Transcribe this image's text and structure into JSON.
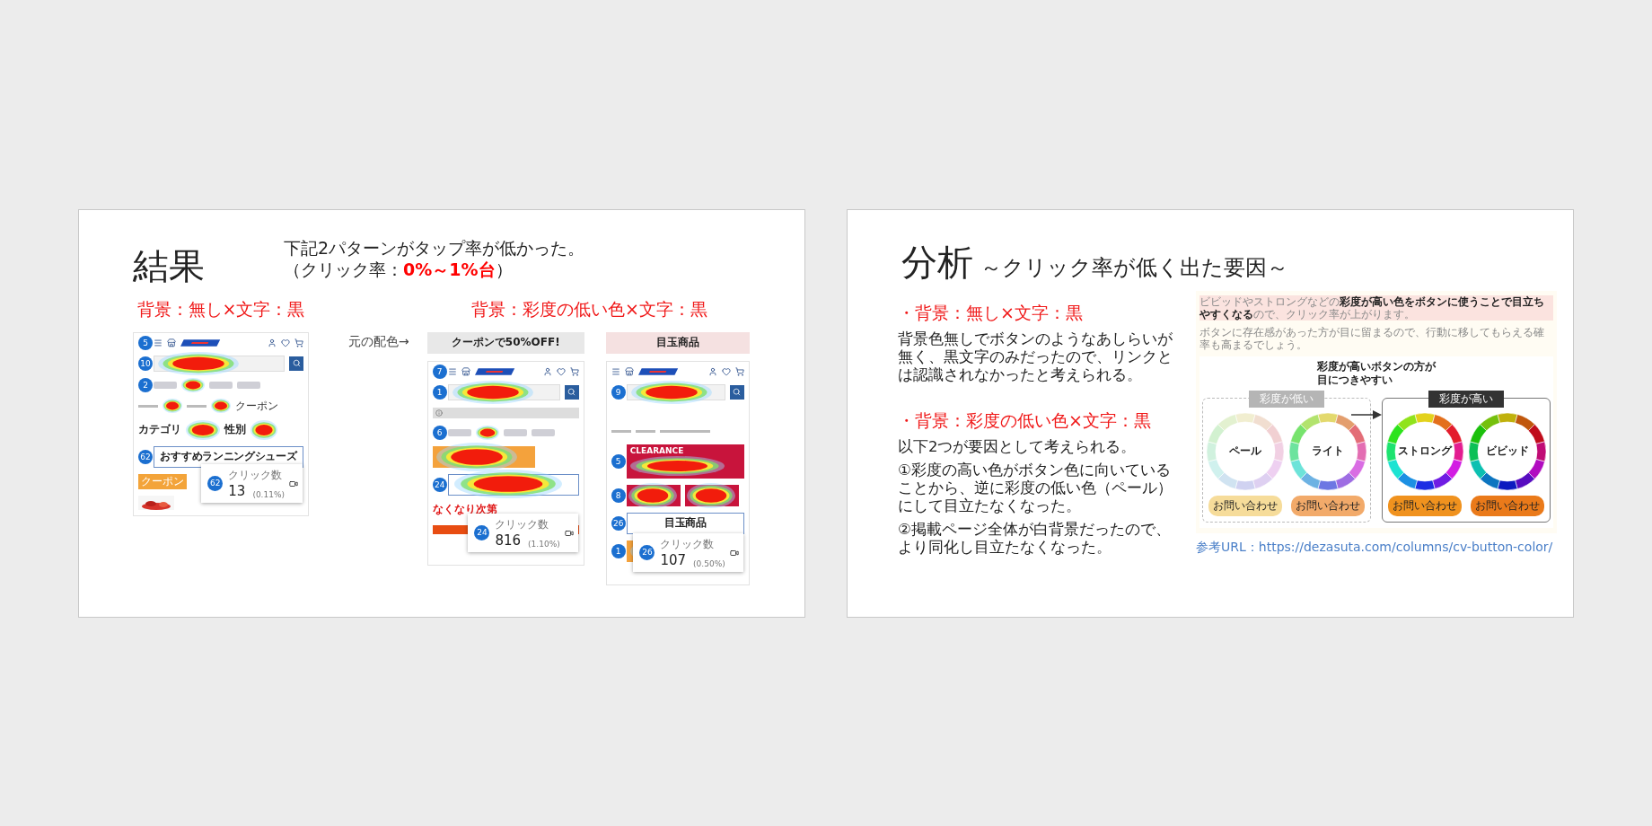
{
  "slides": [
    {
      "kind": "result",
      "title": "結果",
      "lead": "下記2パターンがタップ率が低かった。",
      "lead_rate": "（クリック率：**0%～1%台**）",
      "patterns": [
        {
          "heading": "背景：無し×文字：黒",
          "phones": [
            {
              "items": [
                {
                  "kind": "header",
                  "badge": "5"
                },
                {
                  "kind": "search",
                  "badge": "10"
                },
                {
                  "kind": "tabs",
                  "badge": "2"
                },
                {
                  "kind": "links",
                  "label": "クーポン"
                },
                {
                  "kind": "pair",
                  "labels": [
                    "カテゴリ",
                    "性別"
                  ]
                },
                {
                  "kind": "button",
                  "label": "おすすめランニングシューズ",
                  "badge": "62"
                },
                {
                  "kind": "tag",
                  "label": "クーポン"
                },
                {
                  "kind": "picture"
                }
              ],
              "popup": {
                "title": "クリック数",
                "count": "13",
                "rate": "(0.11%)",
                "badge": "62"
              }
            }
          ]
        },
        {
          "heading": "背景：彩度の低い色×文字：黒",
          "note": "元の配色→",
          "phones": [
            {
              "bar": {
                "label": "クーポンで50%OFF!",
                "color": "#e8e8e8"
              },
              "items": [
                {
                  "kind": "header",
                  "badge": "7"
                },
                {
                  "kind": "search",
                  "badge": "1"
                },
                {
                  "kind": "notice"
                },
                {
                  "kind": "tabs",
                  "badge": "6"
                },
                {
                  "kind": "block"
                },
                {
                  "kind": "heatbutton",
                  "badge": "24"
                },
                {
                  "kind": "redtext",
                  "label": "なくなり次第"
                },
                {
                  "kind": "redbar"
                }
              ],
              "popup": {
                "title": "クリック数",
                "count": "816",
                "rate": "(1.10%)",
                "badge": "24"
              }
            },
            {
              "bar": {
                "label": "目玉商品",
                "color": "#f5e1e1"
              },
              "items": [
                {
                  "kind": "header"
                },
                {
                  "kind": "search",
                  "badge": "9"
                },
                {
                  "kind": "spacer"
                },
                {
                  "kind": "crumbs"
                },
                {
                  "kind": "banner",
                  "label": "CLEARANCE",
                  "badge": "5"
                },
                {
                  "kind": "twin",
                  "badge": "8"
                },
                {
                  "kind": "button",
                  "label": "目玉商品",
                  "badge": "26"
                },
                {
                  "kind": "block",
                  "badge": "1"
                }
              ],
              "popup": {
                "title": "クリック数",
                "count": "107",
                "rate": "(0.50%)",
                "badge": "26"
              }
            }
          ]
        }
      ]
    },
    {
      "kind": "analysis",
      "title": "分析",
      "subtitle": "～クリック率が低く出た要因～",
      "sections": [
        {
          "heading": "・背景：無し×文字：黒",
          "paragraphs": [
            "背景色無しでボタンのようなあしらいが無く、黒文字のみだったので、リンクとは認識されなかったと考えられる。"
          ]
        },
        {
          "heading": "・背景：彩度の低い色×文字：黒",
          "paragraphs": [
            "以下2つが要因として考えられる。",
            "①彩度の高い色がボタン色に向いていることから、逆に彩度の低い色（ペール）にして目立たなくなった。",
            "②掲載ページ全体が白背景だったので、より同化し目立たなくなった。"
          ]
        }
      ],
      "reference": {
        "paragraphs": [
          "ビビッドやストロングなどの**彩度が高い色をボタンに使うことで目立ちやすくなる**ので、クリック率が上がります。",
          "ボタンに存在感があった方が目に留まるので、行動に移してもらえる確率も高まるでしょう。"
        ],
        "diagram_title": "彩度が高いボタンの方が目につきやすい",
        "groups": [
          {
            "label": "彩度が低い",
            "kind": "low",
            "wheels": [
              {
                "label": "ペール",
                "button": "お問い合わせ",
                "color": "#f6dc9a"
              },
              {
                "label": "ライト",
                "button": "お問い合わせ",
                "color": "#f2aa6a"
              }
            ]
          },
          {
            "label": "彩度が高い",
            "kind": "high",
            "wheels": [
              {
                "label": "ストロング",
                "button": "お問い合わせ",
                "color": "#f0921e"
              },
              {
                "label": "ビビッド",
                "button": "お問い合わせ",
                "color": "#ea7a1a"
              }
            ]
          }
        ],
        "url": "参考URL：https://dezasuta.com/columns/cv-button-color/"
      }
    }
  ]
}
